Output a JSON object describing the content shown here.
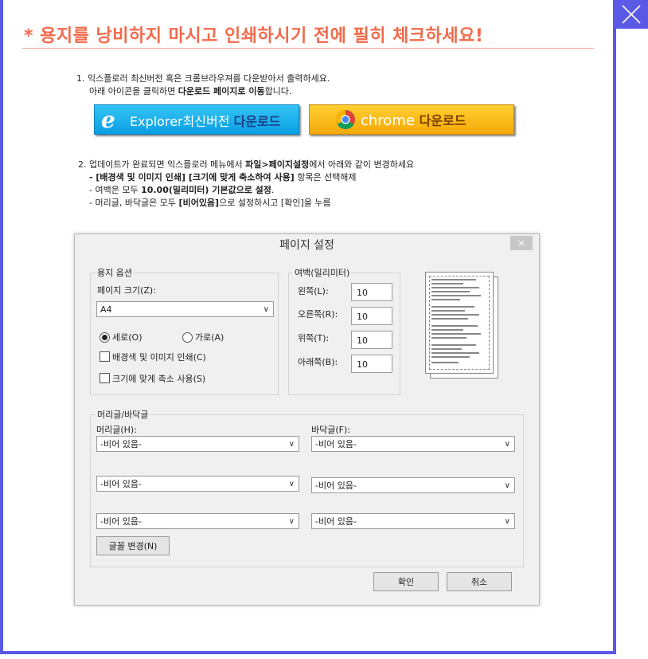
{
  "title": "* 용지를 낭비하지 마시고 인쇄하시기 전에 필히 체크하세요!",
  "step1": {
    "line1": "1. 익스플로러 최신버전 혹은 크롬브라우져를 다운받아서 출력하세요.",
    "line2_pre": "아래 아이콘을 클릭하면 ",
    "line2_bold": "다운로드 페이지로 이동",
    "line2_post": "합니다."
  },
  "buttons": {
    "ie_label": "Explorer최신버전",
    "ie_download": "다운로드",
    "chrome_label": "chrome",
    "chrome_download": "다운로드"
  },
  "step2": {
    "line1_pre": "2. 업데이트가 완료되면 익스플로러 메뉴에서 ",
    "line1_bold": "파일>페이지설정",
    "line1_post": "에서 아래와 같이 변경하세요",
    "line2_bold": "- [배경색 및 이미지 인쇄] [크기에 맞게 축소하여 사용]",
    "line2_post": " 항목은 선택해제",
    "line3_pre": "- 여백은 모두 ",
    "line3_bold": "10.00(밀리미터) 기본값으로 설정",
    "line3_post": ".",
    "line4_pre": "- 머리글, 바닥글은 모두 ",
    "line4_bold": "[비어있음]",
    "line4_post": "으로 설정하시고 [확인]을 누름"
  },
  "dialog": {
    "title": "페이지 설정",
    "close": "×",
    "paper_group": "용지 옵션",
    "paper_size_label": "페이지 크기(Z):",
    "paper_size_value": "A4",
    "portrait": "세로(O)",
    "landscape": "가로(A)",
    "orientation_selected": "portrait",
    "bg_print": "배경색 및 이미지 인쇄(C)",
    "shrink_fit": "크기에 맞게 축소 사용(S)",
    "margin_group": "여백(밀리미터)",
    "margin_left_label": "왼쪽(L):",
    "margin_right_label": "오른쪽(R):",
    "margin_top_label": "위쪽(T):",
    "margin_bottom_label": "아래쪽(B):",
    "margin_left": "10",
    "margin_right": "10",
    "margin_top": "10",
    "margin_bottom": "10",
    "hf_group": "머리글/바닥글",
    "header_label": "머리글(H):",
    "footer_label": "바닥글(F):",
    "header1": "-비어 있음-",
    "header2": "-비어 있음-",
    "header3": "-비어 있음-",
    "footer1": "-비어 있음-",
    "footer2": "-비어 있음-",
    "footer3": "-비어 있음-",
    "font_button": "글꼴 변경(N)",
    "ok": "확인",
    "cancel": "취소"
  },
  "colors": {
    "accent": "#5a5ae6",
    "title": "#f26a4b",
    "ie_button": "#0a9fe4",
    "chrome_button": "#f5a90a"
  }
}
